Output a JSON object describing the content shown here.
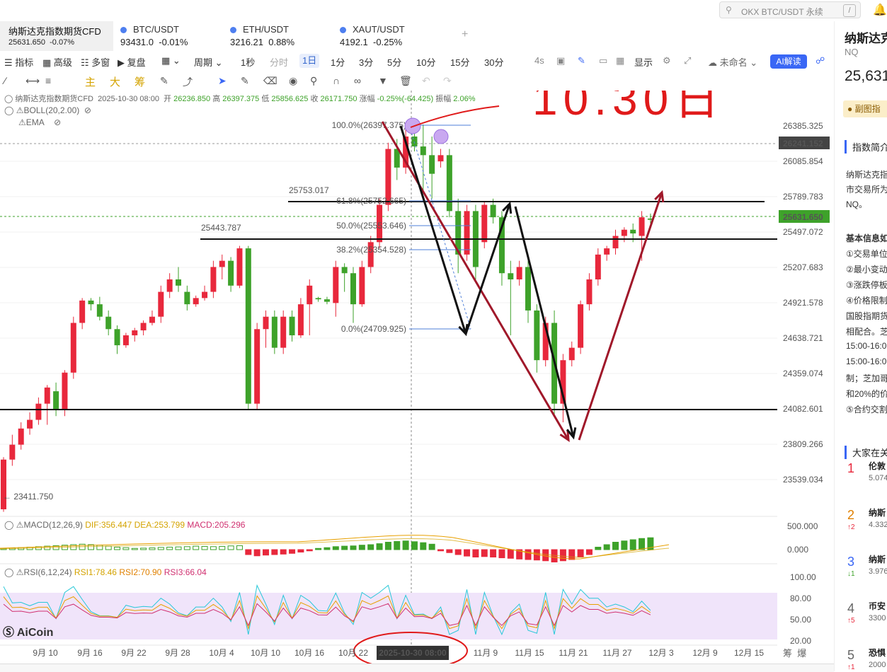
{
  "search": {
    "placeholder": "OKX BTC/USDT 永续",
    "shortcut": "/"
  },
  "tabs": [
    {
      "name": "纳斯达克指数期货CFD",
      "price": "25631.650",
      "change": "-0.07%"
    },
    {
      "name": "BTC/USDT",
      "price": "93431.0",
      "change": "-0.01%"
    },
    {
      "name": "ETH/USDT",
      "price": "3216.21",
      "change": "0.88%"
    },
    {
      "name": "XAUT/USDT",
      "price": "4192.1",
      "change": "-0.25%"
    }
  ],
  "add_tab": "+",
  "toolbar": {
    "indicator": "指标",
    "advanced": "高级",
    "multi": "多窗",
    "replay": "复盘",
    "period": "周期",
    "intervals": [
      "1秒",
      "分时",
      "1日",
      "1分",
      "3分",
      "5分",
      "10分",
      "15分",
      "30分"
    ],
    "active_interval": "1日",
    "four_s": "4s",
    "display": "显示",
    "unnamed": "未命名",
    "ai": "AI解读"
  },
  "drawbar": {
    "zhu": "主",
    "da": "大",
    "chou": "筹"
  },
  "info": {
    "symbol": "纳斯达克指数期货CFD",
    "date": "2025-10-30 08:00",
    "open_label": "开",
    "open": "26236.850",
    "high_label": "高",
    "high": "26397.375",
    "low_label": "低",
    "low": "25856.625",
    "close_label": "收",
    "close": "26171.750",
    "change_label": "涨幅",
    "change": "-0.25%(-64.425)",
    "amp_label": "振幅",
    "amp": "2.06%",
    "boll": "BOLL(20,2.00)",
    "ema": "EMA"
  },
  "price_axis": {
    "ticks": [
      "26385.325",
      "26085.854",
      "25789.783",
      "25497.072",
      "25207.683",
      "24921.578",
      "24638.721",
      "24359.074",
      "24082.601",
      "23809.266",
      "23539.034"
    ],
    "last_marker": "26241.152",
    "current_marker": "25631.650"
  },
  "fib": {
    "top": "100.0%(26397.375)",
    "r618": "61.8%(25752.665)",
    "r50": "50.0%(25553.646)",
    "r382": "38.2%(25354.528)",
    "bottom": "0.0%(24709.925)"
  },
  "levels": {
    "upper": "25753.017",
    "middle": "25443.787",
    "low_label": "23411.750"
  },
  "annotation": "10.30日",
  "macd": {
    "title": "MACD(12,26,9)",
    "dif": "DIF:356.447",
    "dea": "DEA:253.799",
    "macd": "MACD:205.296",
    "axis": [
      "500.000",
      "0.000"
    ]
  },
  "rsi": {
    "title": "RSI(6,12,24)",
    "rsi1": "RSI1:78.46",
    "rsi2": "RSI2:70.90",
    "rsi3": "RSI3:66.04",
    "axis": [
      "100.00",
      "80.00",
      "50.00",
      "20.00"
    ]
  },
  "logo": "AiCoin",
  "dates": [
    "9月 10",
    "9月 16",
    "9月 22",
    "9月 28",
    "10月 4",
    "10月 10",
    "10月 16",
    "10月 22",
    "11月 9",
    "11月 15",
    "11月 21",
    "11月 27",
    "12月 3",
    "12月 9",
    "12月 15"
  ],
  "date_cursor": "2025-10-30 08:00",
  "corner": {
    "chou": "筹",
    "bao": "爆"
  },
  "sidebar": {
    "title": "纳斯达克",
    "sub": "NQ",
    "price": "25,631",
    "subchart": "副图指",
    "section1": "指数简介",
    "desc": [
      "纳斯达克指",
      "市交易所为",
      "NQ。"
    ],
    "basic": "基本信息如",
    "items": [
      "①交易单位",
      "②最小变动",
      "③涨跌停板",
      "④价格限制",
      "国股指期货",
      "相配合。芝",
      "15:00-16:0",
      "15:00-16:0",
      "制；芝加哥",
      "和20%的价",
      "⑤合约交割"
    ],
    "section2": "大家在关",
    "rank": [
      {
        "n": "1",
        "name": "伦敦",
        "val": "5.074",
        "delta": ""
      },
      {
        "n": "2",
        "name": "纳斯",
        "val": "4.332",
        "delta": "↑2"
      },
      {
        "n": "3",
        "name": "纳斯",
        "val": "3.976",
        "delta": "↓1"
      },
      {
        "n": "4",
        "name": "币安",
        "val": "3300",
        "delta": "↑5"
      },
      {
        "n": "5",
        "name": "恐惧",
        "val": "2000",
        "delta": "↑1"
      }
    ]
  },
  "colors": {
    "up": "#e8283c",
    "down": "#3ea22a",
    "accent": "#3a67f5",
    "annot": "#e01a1a",
    "arrow_red": "#a0182a"
  },
  "candles": [
    [
      23300,
      23700,
      23280,
      23720
    ],
    [
      23700,
      23820,
      23650,
      23900
    ],
    [
      23820,
      23950,
      23780,
      24000
    ],
    [
      23950,
      24020,
      23900,
      24080
    ],
    [
      24020,
      24150,
      23980,
      24200
    ],
    [
      24150,
      24280,
      23980,
      24300
    ],
    [
      24250,
      24100,
      24050,
      24320
    ],
    [
      24100,
      24400,
      24050,
      24420
    ],
    [
      24400,
      24800,
      24350,
      24850
    ],
    [
      24800,
      24980,
      24750,
      25000
    ],
    [
      24980,
      24950,
      24900,
      25000
    ],
    [
      24950,
      24850,
      24820,
      25010
    ],
    [
      24850,
      24750,
      24700,
      24900
    ],
    [
      24750,
      24620,
      24550,
      24780
    ],
    [
      24620,
      24700,
      24600,
      24720
    ],
    [
      24700,
      24740,
      24650,
      24760
    ],
    [
      24740,
      24800,
      24700,
      24820
    ],
    [
      24800,
      24850,
      24780,
      24900
    ],
    [
      24850,
      25050,
      24800,
      25100
    ],
    [
      25050,
      25150,
      25000,
      25200
    ],
    [
      25150,
      25100,
      25050,
      25250
    ],
    [
      25050,
      24950,
      24900,
      25100
    ],
    [
      24950,
      25000,
      24930,
      25020
    ],
    [
      25000,
      25050,
      24980,
      25100
    ],
    [
      25050,
      25250,
      25000,
      25300
    ],
    [
      25250,
      25300,
      25150,
      25350
    ],
    [
      25300,
      25100,
      25050,
      25330
    ],
    [
      25100,
      25400,
      25080,
      25420
    ],
    [
      25400,
      24150,
      24100,
      25420
    ],
    [
      24150,
      24750,
      24100,
      24800
    ],
    [
      24750,
      24850,
      24600,
      24900
    ],
    [
      24850,
      24600,
      24550,
      24900
    ],
    [
      24600,
      24850,
      24550,
      24900
    ],
    [
      24850,
      24700,
      24650,
      24900
    ],
    [
      24700,
      24950,
      24680,
      25000
    ],
    [
      24950,
      25100,
      24700,
      25150
    ],
    [
      25000,
      24990,
      24970,
      25010
    ],
    [
      24990,
      24970,
      24950,
      25010
    ],
    [
      24960,
      25250,
      24850,
      25300
    ],
    [
      25250,
      25200,
      25050,
      25280
    ],
    [
      25200,
      24950,
      24800,
      25250
    ],
    [
      24950,
      25250,
      24930,
      25300
    ],
    [
      25250,
      25450,
      25200,
      25500
    ],
    [
      25450,
      25750,
      25400,
      25800
    ],
    [
      25750,
      26200,
      25700,
      26250
    ],
    [
      26200,
      26050,
      25950,
      26280
    ],
    [
      26050,
      26300,
      26000,
      26397
    ],
    [
      26300,
      26220,
      26180,
      26350
    ],
    [
      26220,
      26150,
      25850,
      26397
    ],
    [
      26150,
      26000,
      25800,
      26300
    ],
    [
      26100,
      26150,
      26050,
      26200
    ],
    [
      26150,
      25700,
      25650,
      26200
    ],
    [
      25700,
      25350,
      25200,
      25800
    ],
    [
      25350,
      25700,
      25300,
      25750
    ],
    [
      25700,
      25250,
      25150,
      25750
    ],
    [
      25450,
      25750,
      25400,
      25780
    ],
    [
      25750,
      25650,
      25600,
      25800
    ],
    [
      25650,
      25200,
      25100,
      25700
    ],
    [
      25200,
      25150,
      24700,
      25300
    ],
    [
      25150,
      25250,
      25100,
      25300
    ],
    [
      25250,
      24900,
      24800,
      25300
    ],
    [
      24900,
      24500,
      24400,
      24950
    ],
    [
      24500,
      24800,
      24450,
      24850
    ],
    [
      24800,
      24150,
      24050,
      24900
    ],
    [
      24150,
      24500,
      24000,
      24550
    ],
    [
      24500,
      24600,
      24450,
      24650
    ],
    [
      24600,
      24950,
      24550,
      24980
    ],
    [
      24950,
      25150,
      24900,
      25200
    ],
    [
      25150,
      25350,
      25100,
      25400
    ],
    [
      25350,
      25400,
      25300,
      25420
    ],
    [
      25400,
      25500,
      25350,
      25550
    ],
    [
      25500,
      25550,
      25450,
      25570
    ],
    [
      25550,
      25520,
      25450,
      25600
    ],
    [
      25500,
      25650,
      25300,
      25700
    ],
    [
      25640,
      25630,
      25600,
      25680
    ]
  ]
}
